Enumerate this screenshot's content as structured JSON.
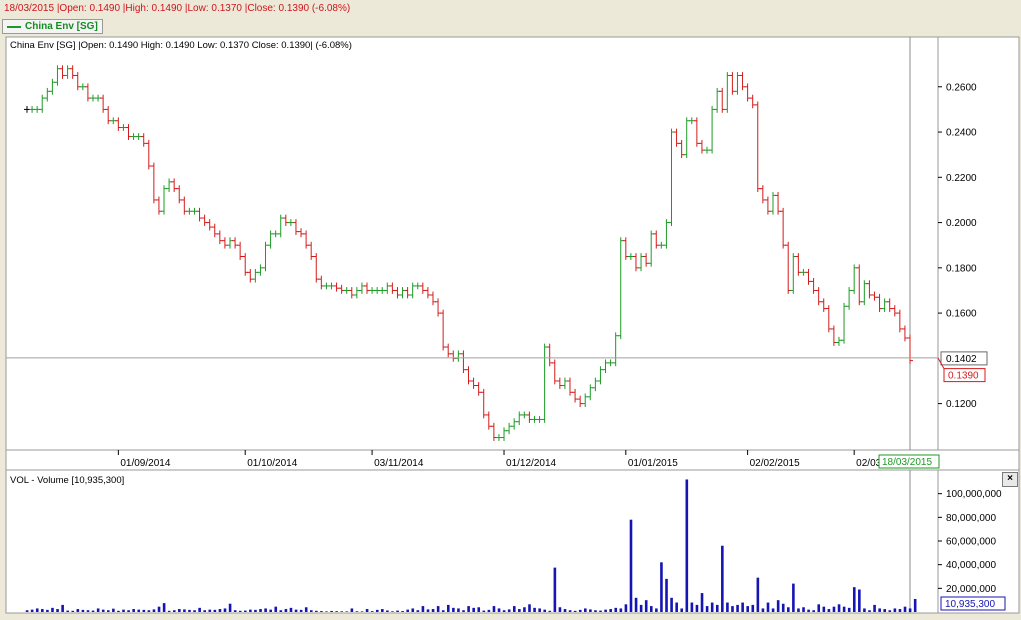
{
  "header": {
    "summary": "18/03/2015 |Open: 0.1490 |High: 0.1490 |Low: 0.1370 |Close: 0.1390 (-6.08%)",
    "legend_tab": "China Env [SG]"
  },
  "colors": {
    "up": "#1d9a26",
    "down": "#d41b1b",
    "volume": "#1515b4",
    "background": "#ffffff",
    "frame": "#ece9d8"
  },
  "icons": {
    "close": "close-icon"
  },
  "chart_data": [
    {
      "type": "candlestick",
      "title": "China Env [SG] |Open: 0.1490   High: 0.1490   Low: 0.1370   Close: 0.1390| (-6.08%)",
      "yticks": [
        "0.2600",
        "0.2400",
        "0.2200",
        "0.2000",
        "0.1800",
        "0.1600",
        "0.1200"
      ],
      "ylim": [
        0.0995,
        0.282
      ],
      "xticks": [
        "01/09/2014",
        "01/10/2014",
        "03/11/2014",
        "01/12/2014",
        "01/01/2015",
        "02/02/2015",
        "02/03/2015"
      ],
      "current_date_label": "18/03/2015",
      "last_price_label": "0.1402",
      "close_price_label": "0.1390",
      "closes": [
        0.25,
        0.25,
        0.25,
        0.255,
        0.258,
        0.262,
        0.268,
        0.265,
        0.268,
        0.265,
        0.26,
        0.26,
        0.255,
        0.255,
        0.255,
        0.25,
        0.245,
        0.245,
        0.242,
        0.242,
        0.238,
        0.238,
        0.238,
        0.235,
        0.225,
        0.21,
        0.205,
        0.215,
        0.218,
        0.215,
        0.21,
        0.205,
        0.205,
        0.205,
        0.202,
        0.2,
        0.198,
        0.195,
        0.192,
        0.19,
        0.192,
        0.19,
        0.185,
        0.178,
        0.175,
        0.178,
        0.18,
        0.19,
        0.195,
        0.195,
        0.202,
        0.2,
        0.2,
        0.196,
        0.195,
        0.19,
        0.185,
        0.175,
        0.172,
        0.172,
        0.172,
        0.171,
        0.17,
        0.17,
        0.168,
        0.17,
        0.172,
        0.17,
        0.17,
        0.17,
        0.17,
        0.172,
        0.17,
        0.168,
        0.17,
        0.168,
        0.172,
        0.172,
        0.17,
        0.168,
        0.165,
        0.16,
        0.145,
        0.142,
        0.14,
        0.142,
        0.135,
        0.13,
        0.128,
        0.125,
        0.115,
        0.11,
        0.105,
        0.105,
        0.108,
        0.11,
        0.112,
        0.115,
        0.115,
        0.113,
        0.113,
        0.113,
        0.145,
        0.138,
        0.13,
        0.128,
        0.13,
        0.125,
        0.122,
        0.12,
        0.123,
        0.127,
        0.13,
        0.135,
        0.138,
        0.138,
        0.15,
        0.192,
        0.185,
        0.185,
        0.18,
        0.185,
        0.182,
        0.195,
        0.19,
        0.19,
        0.2,
        0.24,
        0.235,
        0.23,
        0.245,
        0.245,
        0.235,
        0.232,
        0.232,
        0.25,
        0.258,
        0.25,
        0.265,
        0.258,
        0.265,
        0.26,
        0.255,
        0.252,
        0.215,
        0.21,
        0.205,
        0.212,
        0.205,
        0.19,
        0.17,
        0.185,
        0.178,
        0.178,
        0.174,
        0.17,
        0.165,
        0.162,
        0.153,
        0.147,
        0.148,
        0.163,
        0.17,
        0.18,
        0.165,
        0.173,
        0.168,
        0.167,
        0.162,
        0.165,
        0.162,
        0.16,
        0.153,
        0.149,
        0.139
      ],
      "volume_title": "VOL - Volume [10,935,300]",
      "volume_yticks": [
        "100,000,000",
        "80,000,000",
        "60,000,000",
        "40,000,000",
        "20,000,000"
      ],
      "volume_ylim": [
        0,
        120000000
      ],
      "volume_last_label": "10,935,300",
      "volumes": [
        1500000,
        2000000,
        3000000,
        2500000,
        1800000,
        3500000,
        2500000,
        6000000,
        1200000,
        1000000,
        2500000,
        1800000,
        1500000,
        1200000,
        3000000,
        2000000,
        1500000,
        2800000,
        1000000,
        2000000,
        1500000,
        2500000,
        2000000,
        1800000,
        1500000,
        2200000,
        4500000,
        7500000,
        1000000,
        1500000,
        2500000,
        2200000,
        1800000,
        1500000,
        3500000,
        1500000,
        2000000,
        1800000,
        2500000,
        3000000,
        7000000,
        1500000,
        1000000,
        1200000,
        2000000,
        1800000,
        2500000,
        3000000,
        2000000,
        4500000,
        1500000,
        2500000,
        3500000,
        2000000,
        1800000,
        4000000,
        1500000,
        1000000,
        800000,
        500000,
        900000,
        700000,
        600000,
        500000,
        3000000,
        600000,
        500000,
        2500000,
        700000,
        1800000,
        2500000,
        1300000,
        600000,
        1200000,
        800000,
        2000000,
        3000000,
        1500000,
        5000000,
        2200000,
        2500000,
        5000000,
        1500000,
        6000000,
        3500000,
        3000000,
        1500000,
        5000000,
        3500000,
        4000000,
        1200000,
        1800000,
        5000000,
        3000000,
        1500000,
        2200000,
        5000000,
        2500000,
        4000000,
        6500000,
        3500000,
        3000000,
        2000000,
        1000000,
        37500000,
        4000000,
        2500000,
        1500000,
        1000000,
        1800000,
        3000000,
        2200000,
        1500000,
        1200000,
        2000000,
        2500000,
        3500000,
        3000000,
        6500000,
        78000000,
        12000000,
        6000000,
        10000000,
        5000000,
        3000000,
        42000000,
        28000000,
        12000000,
        8000000,
        3000000,
        112000000,
        8000000,
        6000000,
        16000000,
        5000000,
        8000000,
        6000000,
        56000000,
        8000000,
        5000000,
        6000000,
        8000000,
        5000000,
        6000000,
        29000000,
        3000000,
        8000000,
        3000000,
        10000000,
        7000000,
        4000000,
        24000000,
        3000000,
        4000000,
        2000000,
        1500000,
        6500000,
        4500000,
        2500000,
        4500000,
        6500000,
        4500000,
        3500000,
        21000000,
        19000000,
        3000000,
        1500000,
        6000000,
        3000000,
        2500000,
        1500000,
        3000000,
        2500000,
        4500000,
        3000000,
        11000000
      ]
    }
  ]
}
